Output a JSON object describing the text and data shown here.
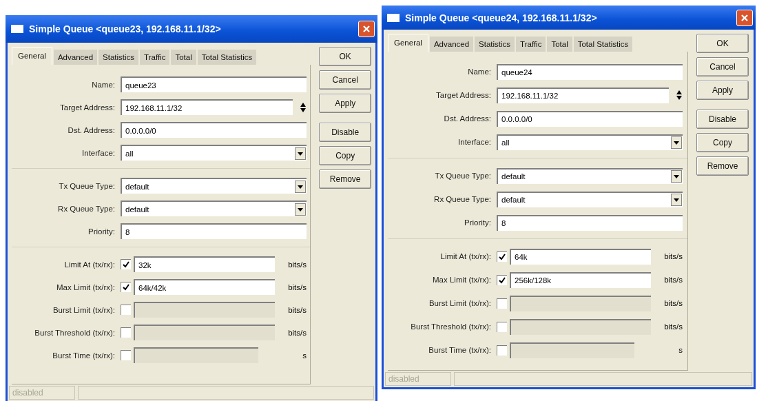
{
  "dialogs": [
    {
      "title": "Simple Queue <queue23, 192.168.11.1/32>",
      "tabs": [
        {
          "label": "General",
          "selected": true
        },
        {
          "label": "Advanced",
          "selected": false
        },
        {
          "label": "Statistics",
          "selected": false
        },
        {
          "label": "Traffic",
          "selected": false
        },
        {
          "label": "Total",
          "selected": false
        },
        {
          "label": "Total Statistics",
          "selected": false
        }
      ],
      "sections": [
        {
          "fields": [
            {
              "kind": "text",
              "label": "Name:",
              "value": "queue23"
            },
            {
              "kind": "spin",
              "label": "Target Address:",
              "value": "192.168.11.1/32"
            },
            {
              "kind": "text",
              "label": "Dst. Address:",
              "value": "0.0.0.0/0"
            },
            {
              "kind": "select",
              "label": "Interface:",
              "value": "all"
            }
          ]
        },
        {
          "fields": [
            {
              "kind": "select",
              "label": "Tx Queue Type:",
              "value": "default"
            },
            {
              "kind": "select",
              "label": "Rx Queue Type:",
              "value": "default"
            },
            {
              "kind": "text",
              "label": "Priority:",
              "value": "8"
            }
          ]
        },
        {
          "fields": [
            {
              "kind": "limit",
              "label": "Limit At (tx/rx):",
              "checked": true,
              "value": "32k",
              "unit": "bits/s"
            },
            {
              "kind": "limit",
              "label": "Max Limit (tx/rx):",
              "checked": true,
              "value": "64k/42k",
              "unit": "bits/s"
            },
            {
              "kind": "limit",
              "label": "Burst Limit (tx/rx):",
              "checked": false,
              "unit": "bits/s"
            },
            {
              "kind": "limit",
              "label": "Burst Threshold (tx/rx):",
              "checked": false,
              "unit": "bits/s"
            },
            {
              "kind": "limit",
              "label": "Burst Time (tx/rx):",
              "checked": false,
              "unit": "s"
            }
          ]
        }
      ],
      "button_groups": [
        [
          "OK",
          "Cancel",
          "Apply"
        ],
        [
          "Disable",
          "Copy",
          "Remove"
        ]
      ],
      "status": "disabled"
    },
    {
      "title": "Simple Queue <queue24, 192.168.11.1/32>",
      "tabs": [
        {
          "label": "General",
          "selected": true
        },
        {
          "label": "Advanced",
          "selected": false
        },
        {
          "label": "Statistics",
          "selected": false
        },
        {
          "label": "Traffic",
          "selected": false
        },
        {
          "label": "Total",
          "selected": false
        },
        {
          "label": "Total Statistics",
          "selected": false
        }
      ],
      "sections": [
        {
          "fields": [
            {
              "kind": "text",
              "label": "Name:",
              "value": "queue24"
            },
            {
              "kind": "spin",
              "label": "Target Address:",
              "value": "192.168.11.1/32"
            },
            {
              "kind": "text",
              "label": "Dst. Address:",
              "value": "0.0.0.0/0"
            },
            {
              "kind": "select",
              "label": "Interface:",
              "value": "all"
            }
          ]
        },
        {
          "fields": [
            {
              "kind": "select",
              "label": "Tx Queue Type:",
              "value": "default"
            },
            {
              "kind": "select",
              "label": "Rx Queue Type:",
              "value": "default"
            },
            {
              "kind": "text",
              "label": "Priority:",
              "value": "8"
            }
          ]
        },
        {
          "fields": [
            {
              "kind": "limit",
              "label": "Limit At (tx/rx):",
              "checked": true,
              "value": "64k",
              "unit": "bits/s"
            },
            {
              "kind": "limit",
              "label": "Max Limit (tx/rx):",
              "checked": true,
              "value": "256k/128k",
              "unit": "bits/s"
            },
            {
              "kind": "limit",
              "label": "Burst Limit (tx/rx):",
              "checked": false,
              "unit": "bits/s"
            },
            {
              "kind": "limit",
              "label": "Burst Threshold (tx/rx):",
              "checked": false,
              "unit": "bits/s"
            },
            {
              "kind": "limit",
              "label": "Burst Time (tx/rx):",
              "checked": false,
              "unit": "s"
            }
          ]
        }
      ],
      "button_groups": [
        [
          "OK",
          "Cancel",
          "Apply"
        ],
        [
          "Disable",
          "Copy",
          "Remove"
        ]
      ],
      "status": "disabled"
    }
  ]
}
